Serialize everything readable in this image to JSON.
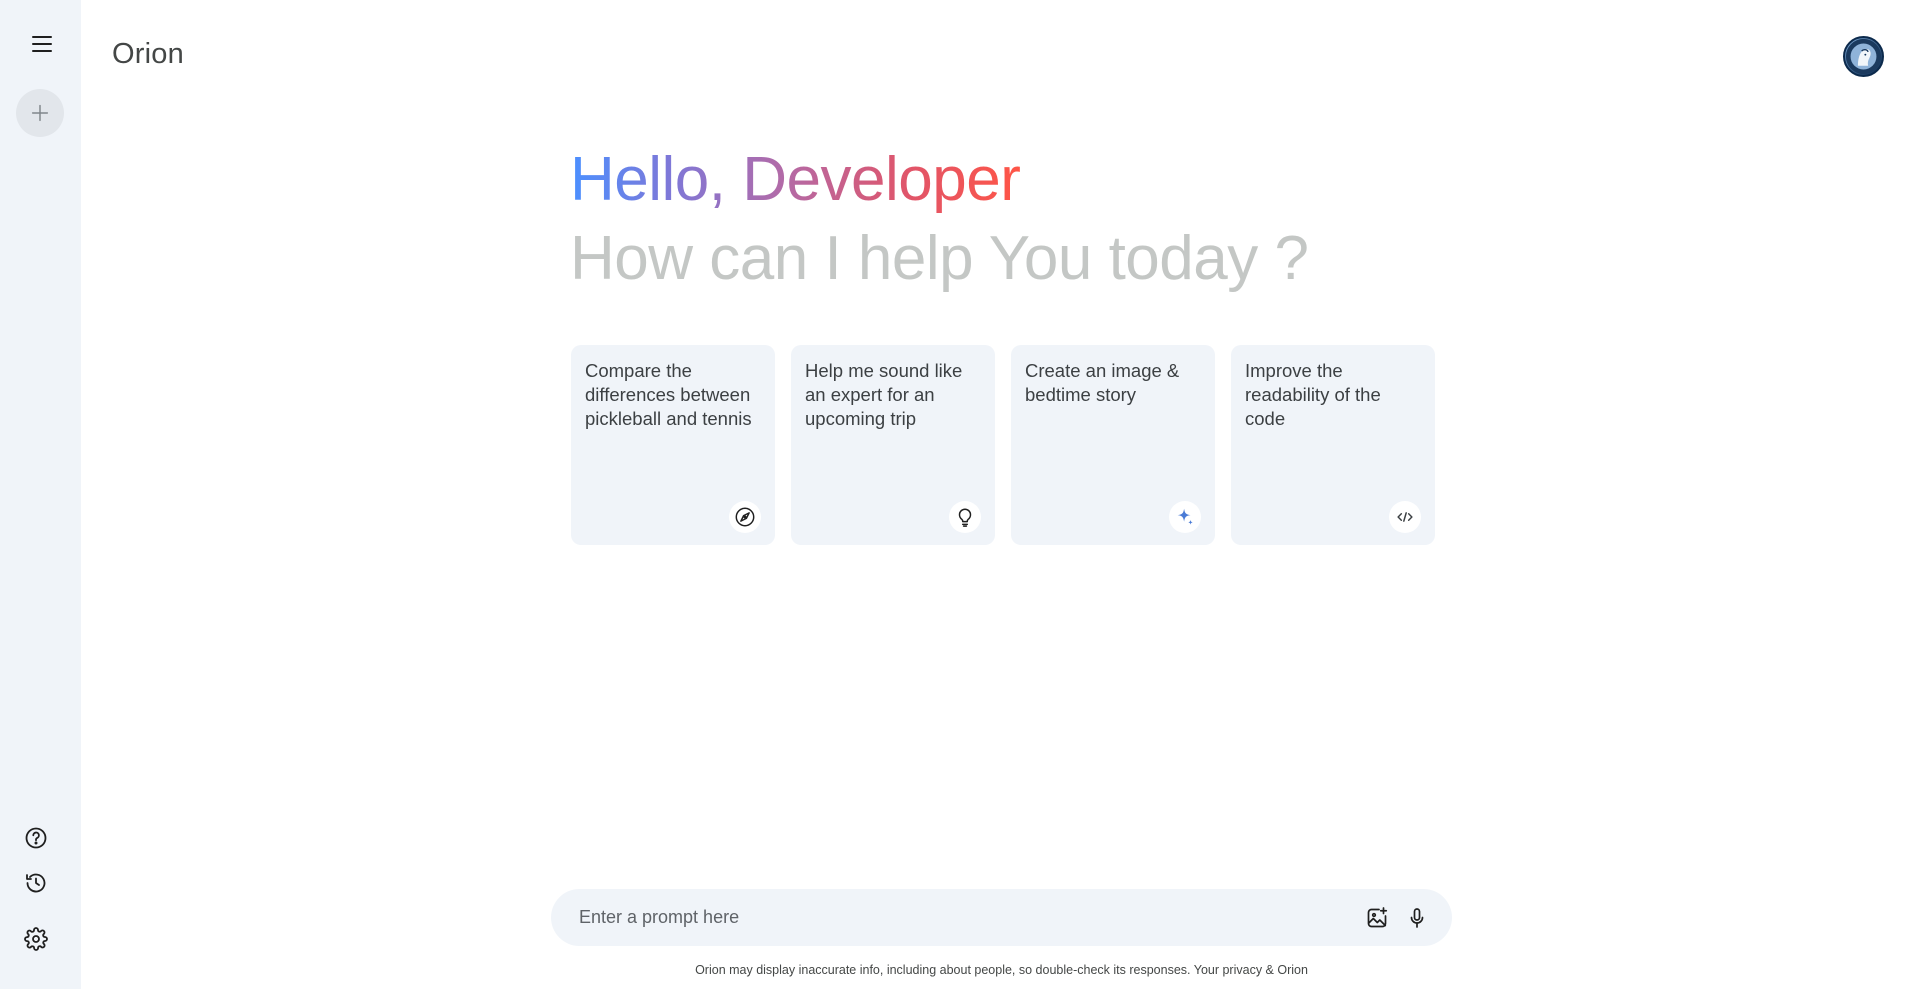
{
  "app": {
    "title": "Orion"
  },
  "sidebar": {
    "menu_icon": "hamburger-menu-icon",
    "new_chat_icon": "plus-icon",
    "bottom_items": [
      {
        "icon": "help-icon"
      },
      {
        "icon": "history-icon"
      },
      {
        "icon": "settings-gear-icon"
      }
    ]
  },
  "header": {
    "avatar_icon": "user-avatar"
  },
  "greeting": {
    "hello": "Hello, Developer",
    "subtitle": "How can I help You today ?"
  },
  "cards": [
    {
      "text": "Compare the differences between pickleball and tennis",
      "icon": "compass-icon"
    },
    {
      "text": "Help me sound like an expert for an upcoming trip",
      "icon": "lightbulb-icon"
    },
    {
      "text": "Create an image & bedtime story",
      "icon": "sparkle-icon"
    },
    {
      "text": "Improve the readability of the code",
      "icon": "code-icon"
    }
  ],
  "prompt": {
    "placeholder": "Enter a prompt here",
    "value": "",
    "image_icon": "add-image-icon",
    "mic_icon": "microphone-icon"
  },
  "footer": {
    "disclaimer": "Orion may display inaccurate info, including about people, so double-check its responses. Your privacy & Orion"
  },
  "colors": {
    "sidebar_bg": "#f0f4f9",
    "card_bg": "#f0f4f9",
    "gradient_start": "#4b90ff",
    "gradient_end": "#ff5546",
    "subtitle": "#c4c7c5"
  }
}
